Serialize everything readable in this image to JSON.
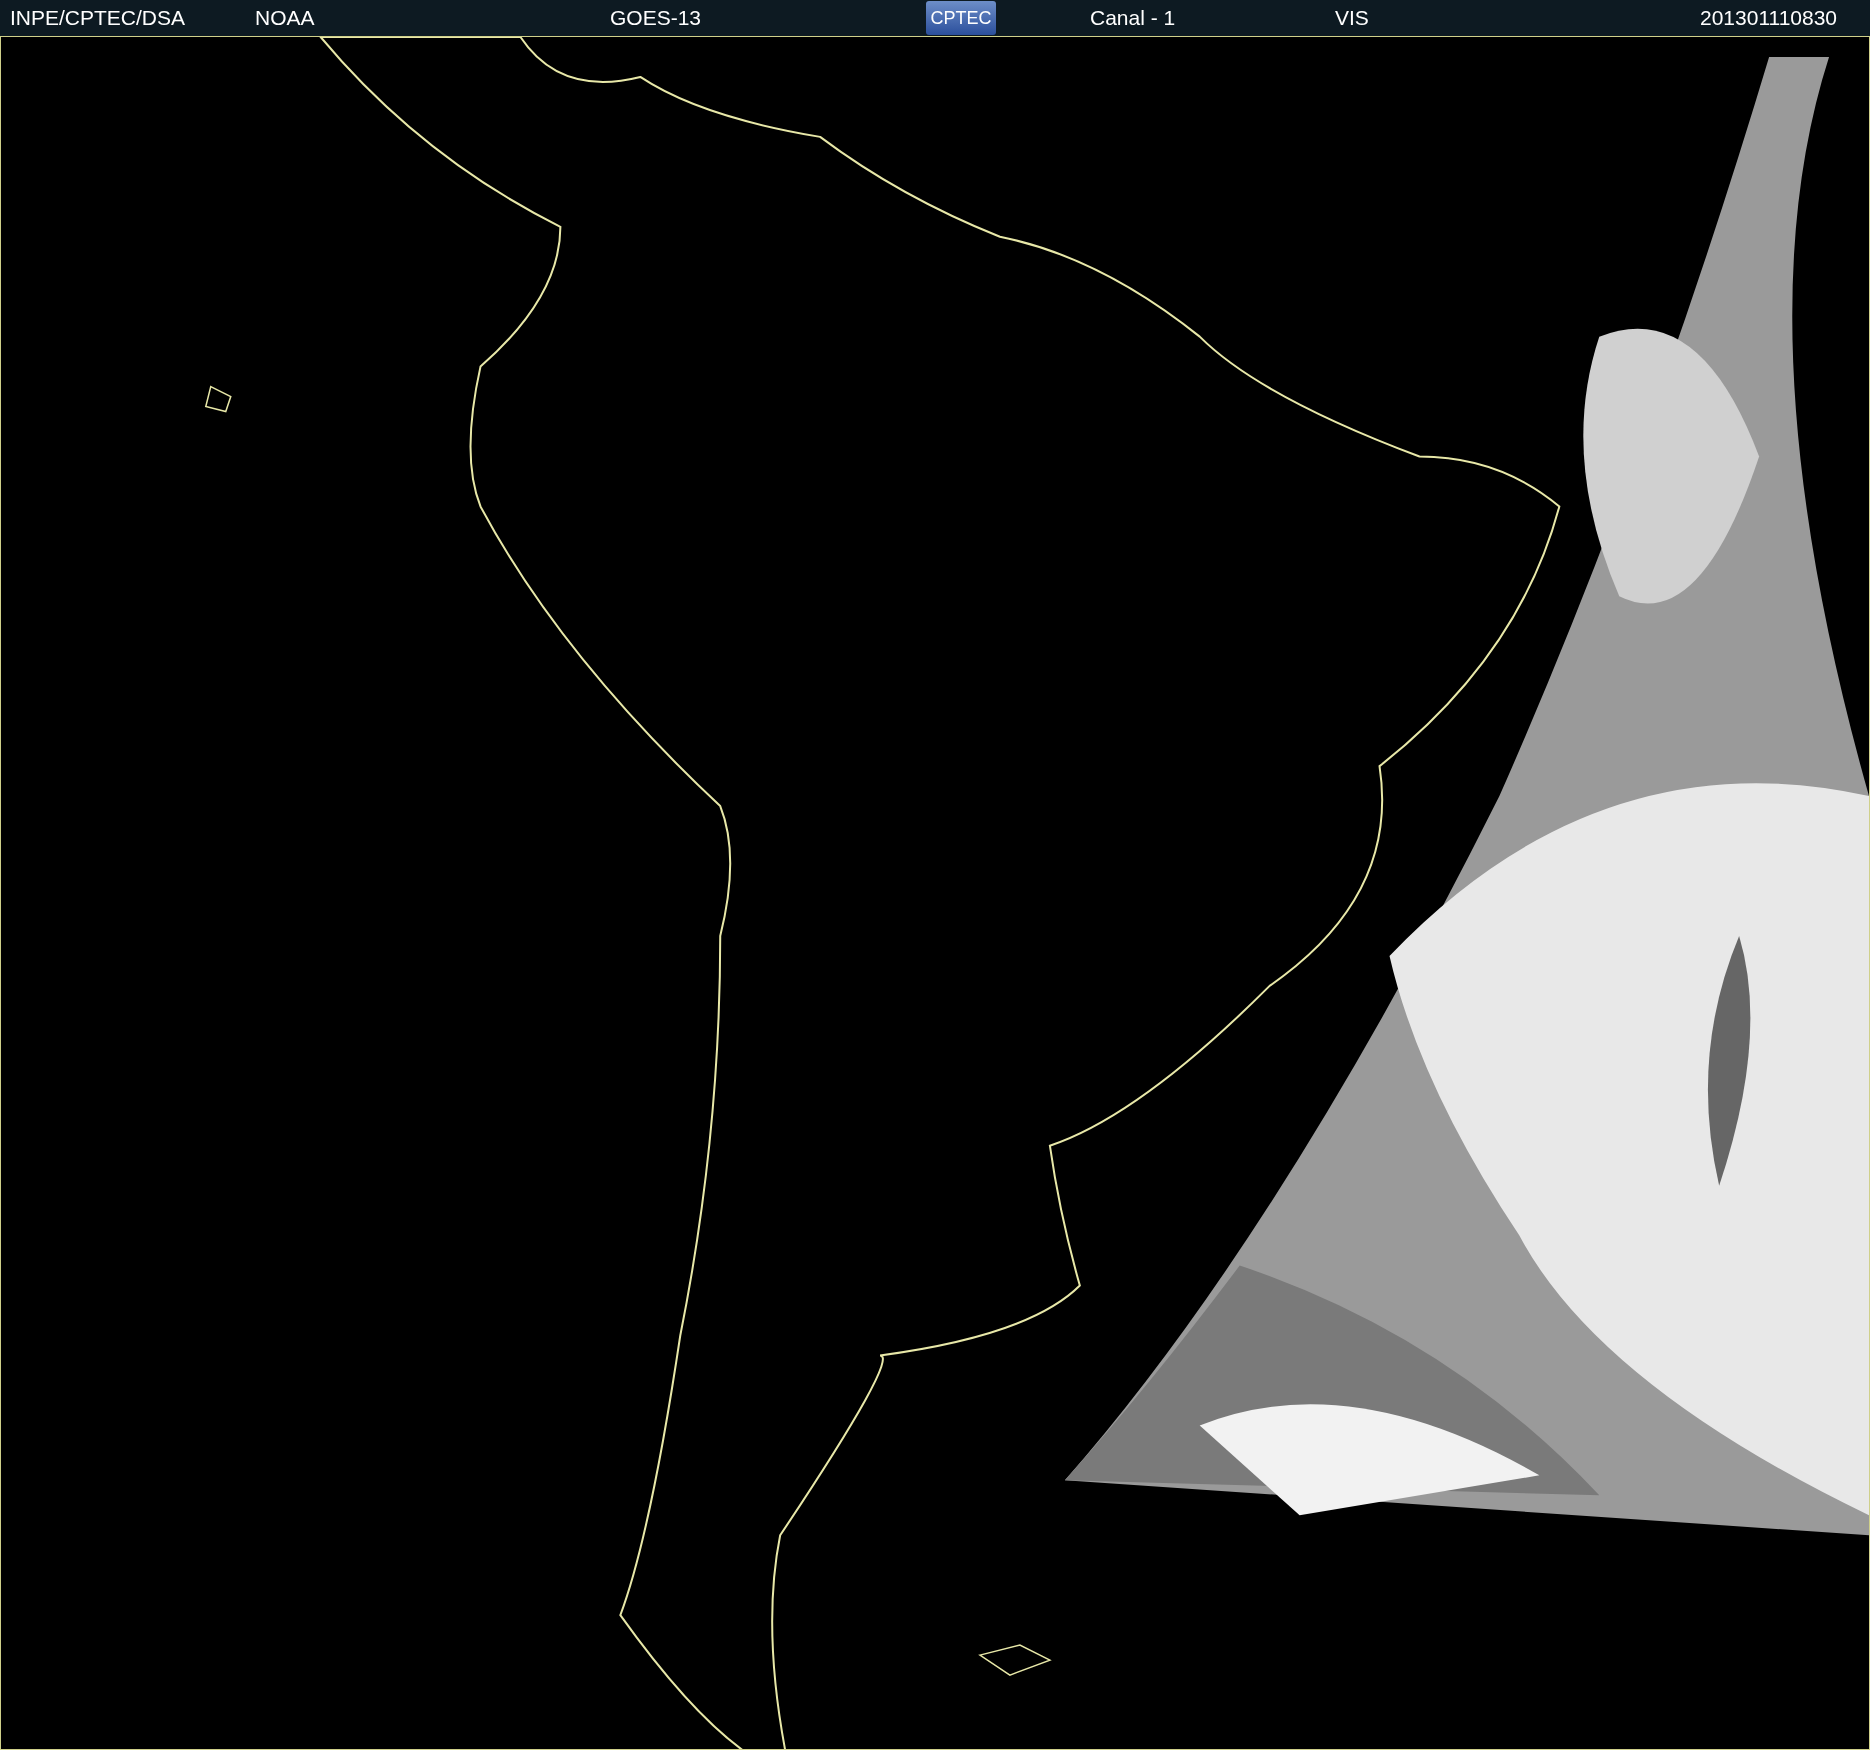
{
  "header": {
    "source": "INPE/CPTEC/DSA",
    "agency": "NOAA",
    "satellite": "GOES-13",
    "logo": "CPTEC",
    "channel": "Canal - 1",
    "band": "VIS",
    "timestamp": "201301110830"
  }
}
